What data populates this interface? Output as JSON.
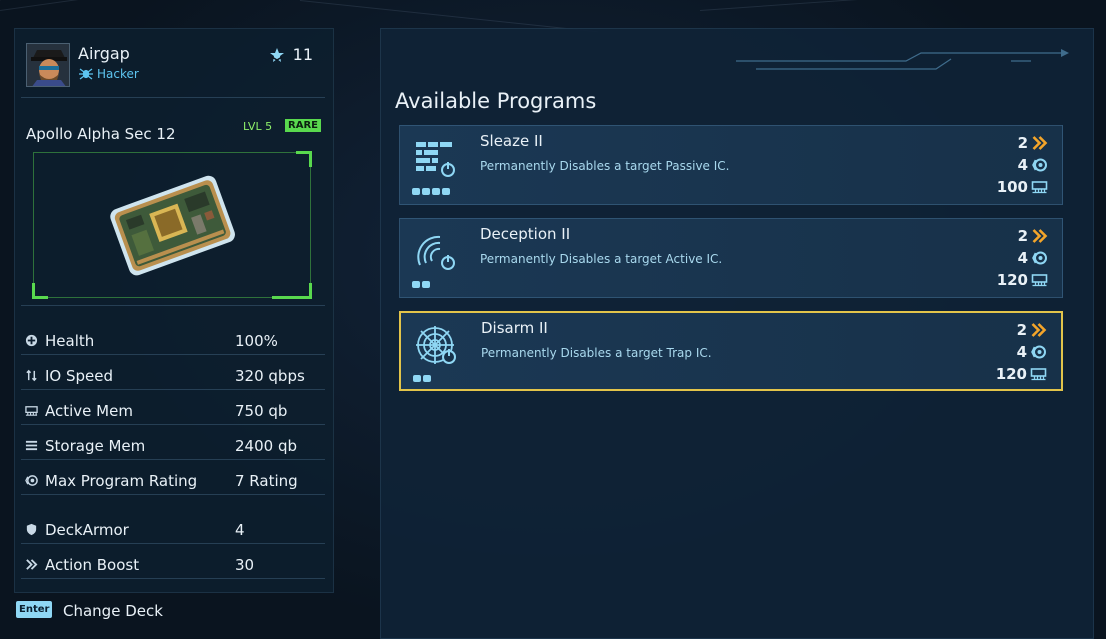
{
  "profile": {
    "name": "Airgap",
    "class": "Hacker",
    "level": "11"
  },
  "deck": {
    "name": "Apollo Alpha Sec 12",
    "level": "LVL 5",
    "rarity": "RARE"
  },
  "stats": [
    {
      "icon": "health-icon",
      "label": "Health",
      "value": "100%"
    },
    {
      "icon": "io-speed-icon",
      "label": "IO Speed",
      "value": "320 qbps"
    },
    {
      "icon": "active-mem-icon",
      "label": "Active Mem",
      "value": "750 qb"
    },
    {
      "icon": "storage-mem-icon",
      "label": "Storage Mem",
      "value": "2400 qb"
    },
    {
      "icon": "rating-icon",
      "label": "Max Program Rating",
      "value": "7 Rating"
    },
    {
      "icon": "shield-icon",
      "label": "DeckArmor",
      "value": "4"
    },
    {
      "icon": "boost-icon",
      "label": "Action Boost",
      "value": "30"
    }
  ],
  "footer": {
    "key": "Enter",
    "action": "Change Deck"
  },
  "programs_title": "Available Programs",
  "programs": [
    {
      "icon": "sleaze-icon",
      "name": "Sleaze II",
      "description": "Permanently Disables a target Passive IC.",
      "boost": "2",
      "rating": "4",
      "memory": "100",
      "dots": 4,
      "selected": false
    },
    {
      "icon": "deception-icon",
      "name": "Deception II",
      "description": "Permanently Disables a target Active IC.",
      "boost": "2",
      "rating": "4",
      "memory": "120",
      "dots": 2,
      "selected": false
    },
    {
      "icon": "disarm-icon",
      "name": "Disarm II",
      "description": "Permanently Disables a target Trap IC.",
      "boost": "2",
      "rating": "4",
      "memory": "120",
      "dots": 2,
      "selected": true
    }
  ],
  "colors": {
    "accent_cyan": "#8fd7f4",
    "boost_orange": "#f4a52a",
    "rare_green": "#59d94e",
    "selected_gold": "#e2c44a"
  }
}
